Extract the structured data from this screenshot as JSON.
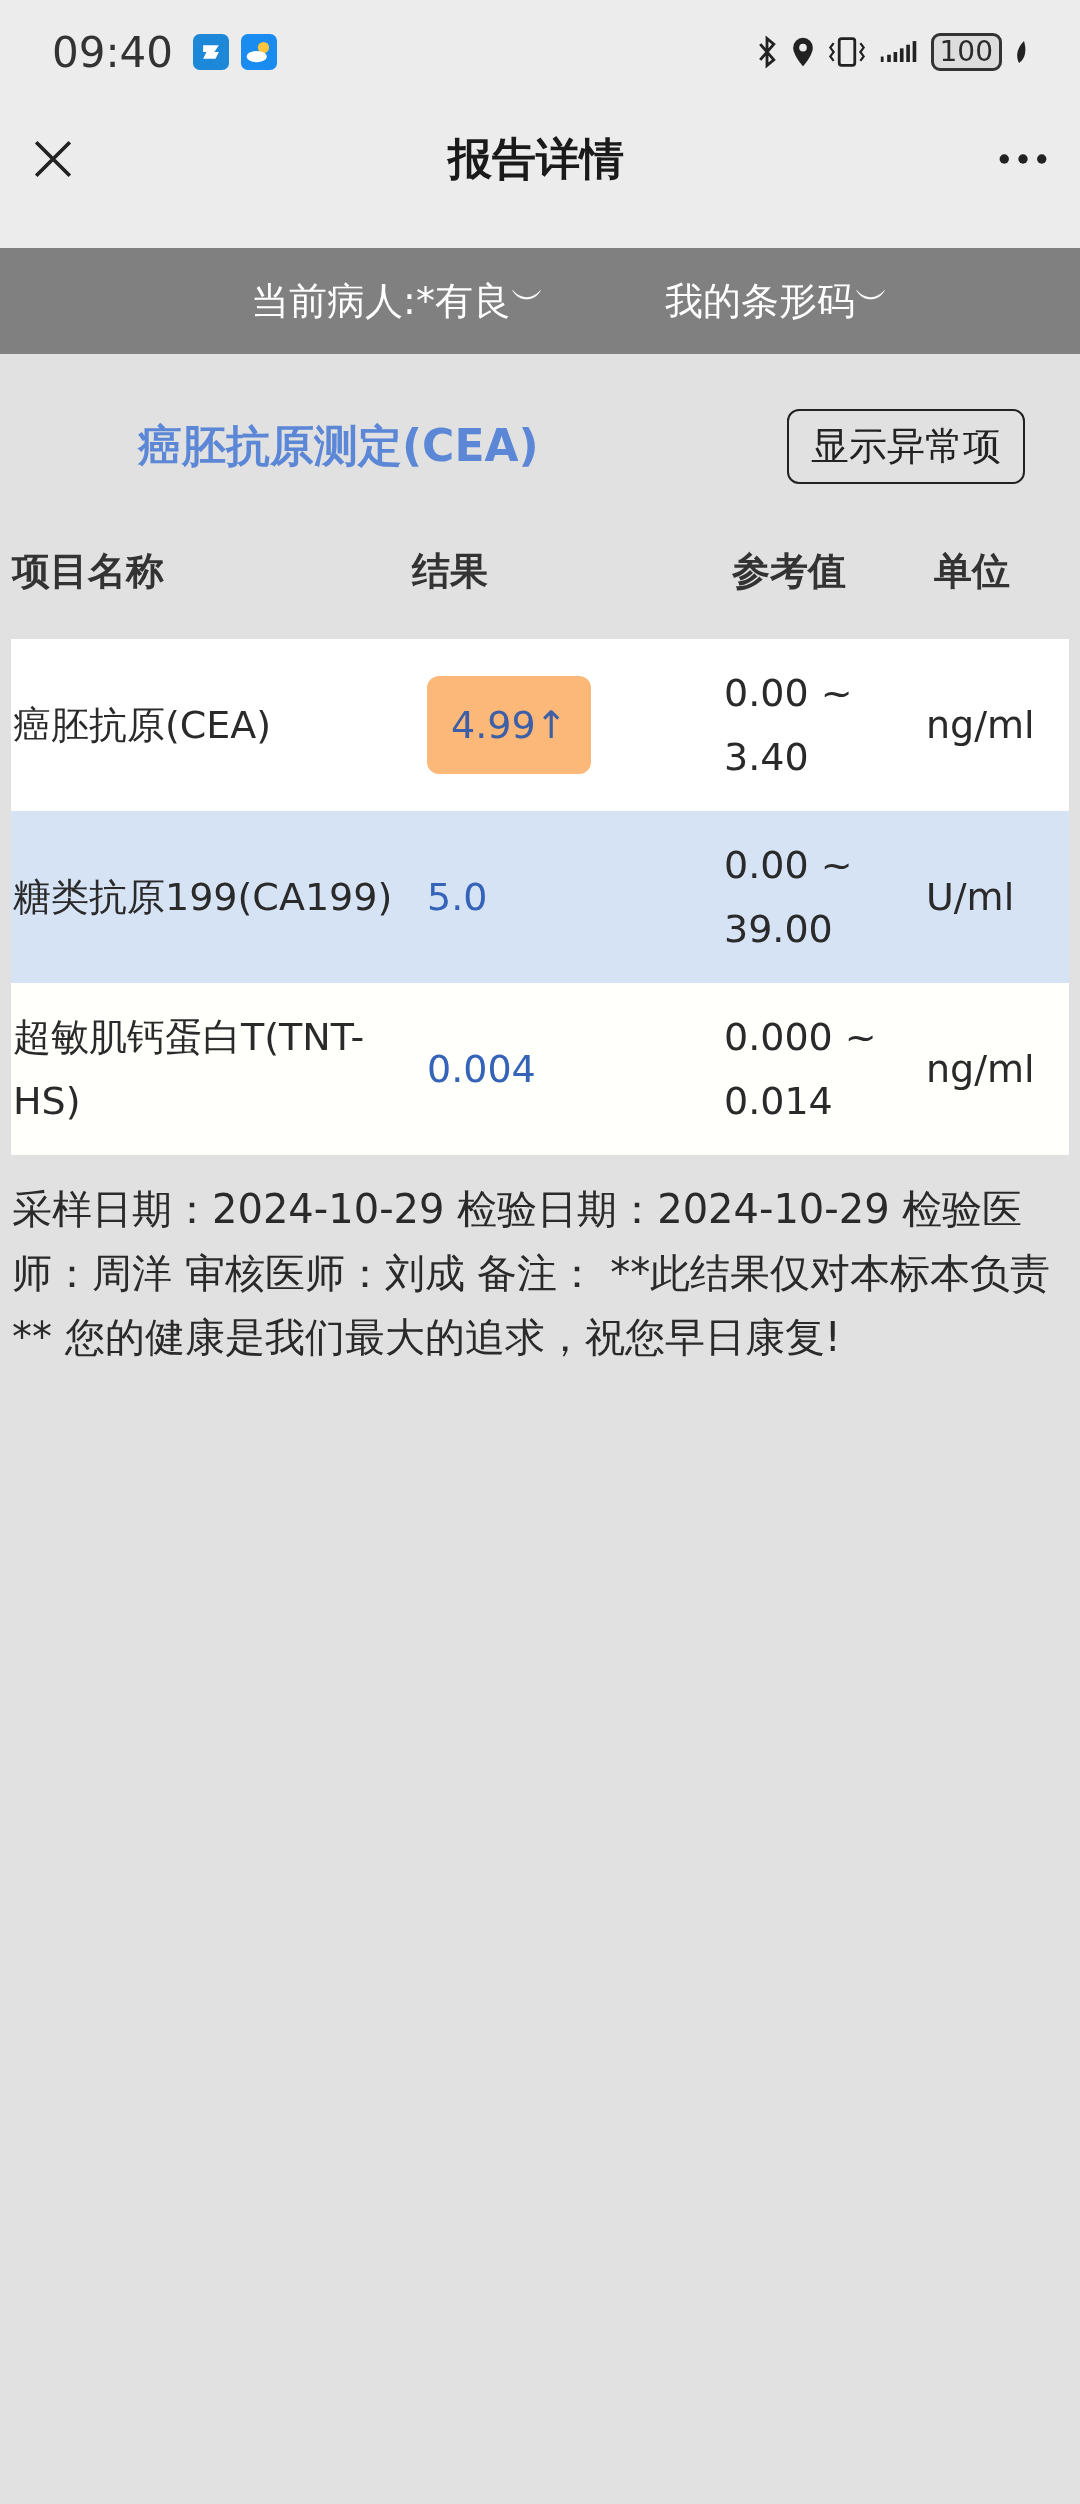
{
  "status_bar": {
    "time": "09:40",
    "battery": "100"
  },
  "nav": {
    "title": "报告详情"
  },
  "filters": [
    {
      "label": "当前病人:*有良",
      "caret": "︶"
    },
    {
      "label": "我的条形码",
      "caret": "︶"
    }
  ],
  "report": {
    "title": "癌胚抗原测定(CEA)",
    "toggle": "显示异常项"
  },
  "table": {
    "columns": [
      "项目名称",
      "结果",
      "参考值",
      "单位"
    ],
    "rows": [
      {
        "name": "癌胚抗原(CEA)",
        "result": "4.99↑",
        "abnormal": true,
        "reference": "0.00 ~ 3.40",
        "unit": "ng/ml"
      },
      {
        "name": "糖类抗原199(CA199)",
        "result": "5.0",
        "abnormal": false,
        "reference": "0.00 ~ 39.00",
        "unit": "U/ml"
      },
      {
        "name": "超敏肌钙蛋白T(TNT-HS)",
        "result": "0.004",
        "abnormal": false,
        "reference": "0.000 ~ 0.014",
        "unit": "ng/ml"
      }
    ]
  },
  "note": "采样日期：2024-10-29 检验日期：2024-10-29 检验医师：周洋 审核医师：刘成 备注：  **此结果仅对本标本负责** 您的健康是我们最大的追求，祝您早日康复!"
}
